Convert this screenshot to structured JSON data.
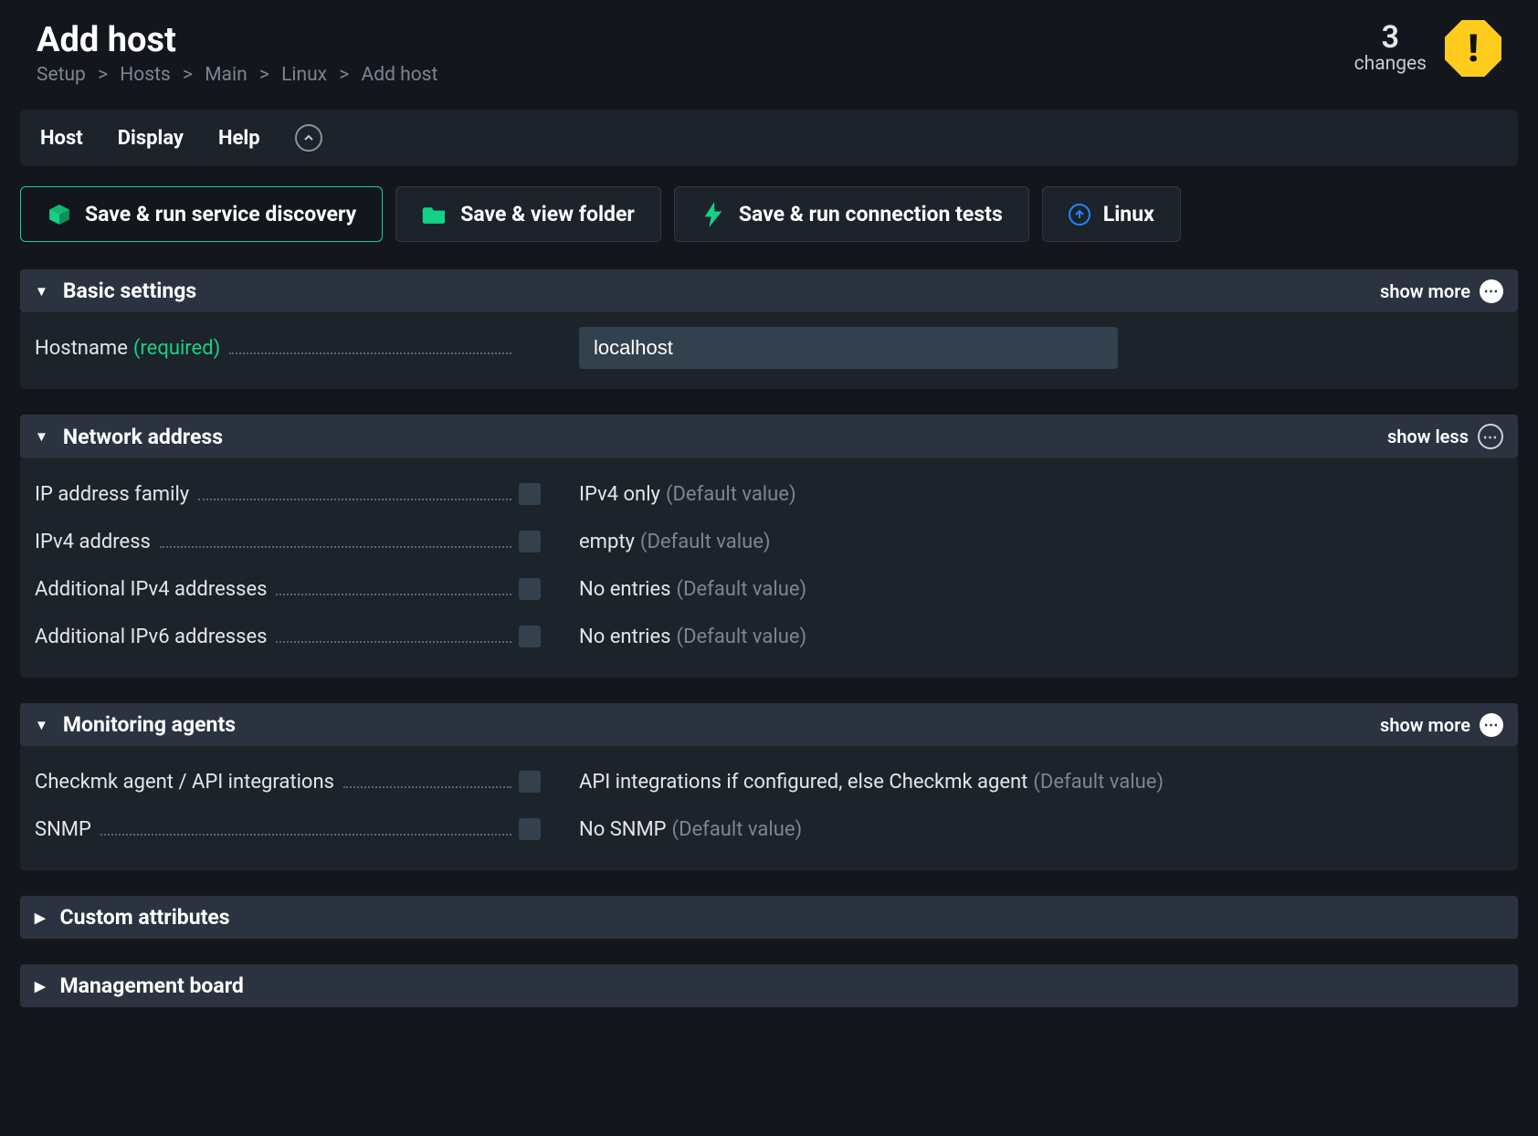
{
  "header": {
    "title": "Add host",
    "breadcrumb": [
      "Setup",
      "Hosts",
      "Main",
      "Linux",
      "Add host"
    ],
    "changes_count": "3",
    "changes_label": "changes"
  },
  "menubar": {
    "items": [
      "Host",
      "Display",
      "Help"
    ]
  },
  "toolbar": {
    "save_discovery": "Save & run service discovery",
    "save_folder": "Save & view folder",
    "save_conn": "Save & run connection tests",
    "linux": "Linux"
  },
  "sections": {
    "basic": {
      "title": "Basic settings",
      "toggle_label": "show more",
      "hostname_label": "Hostname",
      "hostname_required": "(required)",
      "hostname_value": "localhost"
    },
    "network": {
      "title": "Network address",
      "toggle_label": "show less",
      "rows": [
        {
          "label": "IP address family",
          "value": "IPv4 only",
          "def": "(Default value)"
        },
        {
          "label": "IPv4 address",
          "value": "empty",
          "def": "(Default value)"
        },
        {
          "label": "Additional IPv4 addresses",
          "value": "No entries",
          "def": "(Default value)"
        },
        {
          "label": "Additional IPv6 addresses",
          "value": "No entries",
          "def": "(Default value)"
        }
      ]
    },
    "agents": {
      "title": "Monitoring agents",
      "toggle_label": "show more",
      "rows": [
        {
          "label": "Checkmk agent / API integrations",
          "value": "API integrations if configured, else Checkmk agent",
          "def": "(Default value)"
        },
        {
          "label": "SNMP",
          "value": "No SNMP",
          "def": "(Default value)"
        }
      ]
    },
    "custom": {
      "title": "Custom attributes"
    },
    "mgmt": {
      "title": "Management board"
    }
  }
}
